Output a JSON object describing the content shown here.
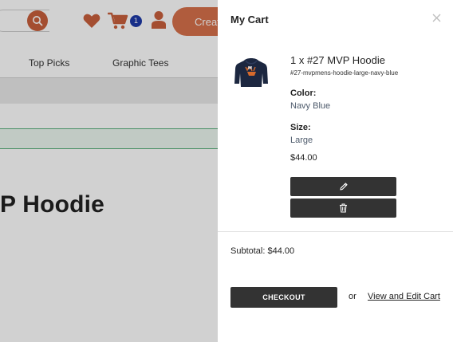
{
  "header": {
    "cart_count": "1",
    "create_label": "Create"
  },
  "nav": {
    "items": [
      {
        "label": "Top Picks"
      },
      {
        "label": "Graphic Tees"
      }
    ]
  },
  "page": {
    "title_partial": "P Hoodie"
  },
  "cart": {
    "title": "My Cart",
    "item": {
      "title": "1 x #27 MVP Hoodie",
      "sku": "#27-mvpmens-hoodie-large-navy-blue",
      "color_label": "Color:",
      "color_value": "Navy Blue",
      "size_label": "Size:",
      "size_value": "Large",
      "price": "$44.00"
    },
    "subtotal": "Subtotal: $44.00",
    "checkout_label": "CHECKOUT",
    "or_text": "or",
    "view_edit_label": "View and Edit Cart"
  },
  "icons": {
    "search": "search-icon",
    "wishlist": "heart-icon",
    "cart": "cart-icon",
    "user": "user-icon",
    "close": "close-icon",
    "edit": "pencil-icon",
    "delete": "trash-icon"
  },
  "colors": {
    "accent": "#d7714b",
    "badge": "#1e3aa8",
    "button_dark": "#333333",
    "option_value": "#4d5a6b"
  }
}
